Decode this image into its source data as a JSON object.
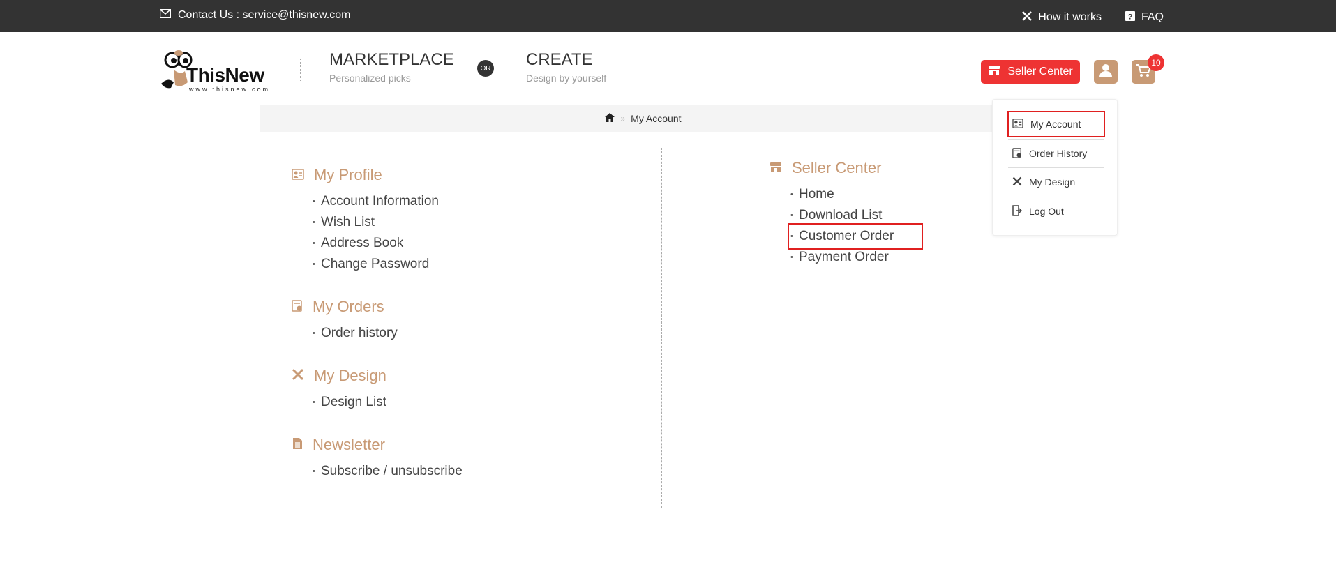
{
  "topbar": {
    "contact": "Contact Us : service@thisnew.com",
    "how_it_works": "How it works",
    "faq": "FAQ"
  },
  "header": {
    "logo_text": "ThisNew",
    "logo_url": "www.thisnew.com",
    "marketplace_title": "MARKETPLACE",
    "marketplace_sub": "Personalized picks",
    "or": "OR",
    "create_title": "CREATE",
    "create_sub": "Design by yourself",
    "seller_center": "Seller Center",
    "cart_count": "10"
  },
  "breadcrumb": {
    "current": "My Account",
    "separator": "»"
  },
  "left": {
    "profile": {
      "title": "My Profile",
      "items": [
        "Account Information",
        "Wish List",
        "Address Book",
        "Change Password"
      ]
    },
    "orders": {
      "title": "My Orders",
      "items": [
        "Order history"
      ]
    },
    "design": {
      "title": "My Design",
      "items": [
        "Design List"
      ]
    },
    "newsletter": {
      "title": "Newsletter",
      "items": [
        "Subscribe / unsubscribe"
      ]
    }
  },
  "right": {
    "seller": {
      "title": "Seller Center",
      "items": [
        "Home",
        "Download List",
        "Customer Order",
        "Payment Order"
      ]
    }
  },
  "dropdown": {
    "items": [
      "My Account",
      "Order History",
      "My Design",
      "Log Out"
    ]
  },
  "colors": {
    "accent": "#c89a75",
    "brand_red": "#ee3333",
    "topbar": "#333333",
    "highlight": "#e02020"
  }
}
